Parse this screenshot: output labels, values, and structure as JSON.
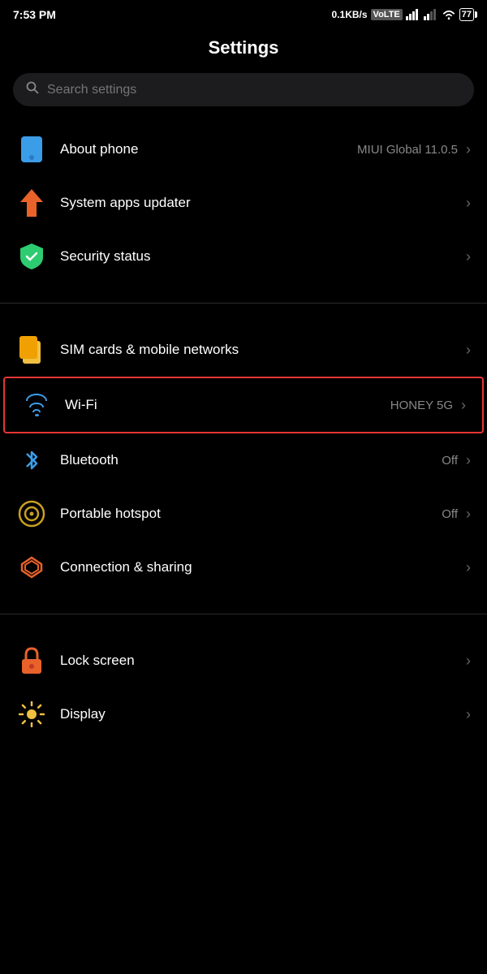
{
  "statusBar": {
    "time": "7:53 PM",
    "speed": "0.1KB/s",
    "networkType": "VoLTE",
    "battery": "77"
  },
  "page": {
    "title": "Settings"
  },
  "search": {
    "placeholder": "Search settings"
  },
  "items": {
    "aboutPhone": {
      "label": "About phone",
      "value": "MIUI Global 11.0.5"
    },
    "systemApps": {
      "label": "System apps updater",
      "value": ""
    },
    "securityStatus": {
      "label": "Security status",
      "value": ""
    },
    "simCards": {
      "label": "SIM cards & mobile networks",
      "value": ""
    },
    "wifi": {
      "label": "Wi-Fi",
      "value": "HONEY 5G"
    },
    "bluetooth": {
      "label": "Bluetooth",
      "value": "Off"
    },
    "portableHotspot": {
      "label": "Portable hotspot",
      "value": "Off"
    },
    "connectionSharing": {
      "label": "Connection & sharing",
      "value": ""
    },
    "lockScreen": {
      "label": "Lock screen",
      "value": ""
    },
    "display": {
      "label": "Display",
      "value": ""
    }
  },
  "icons": {
    "chevron": "›",
    "search": "🔍",
    "bluetooth": "Ƀ",
    "lock": "🔒",
    "display": "☀"
  }
}
